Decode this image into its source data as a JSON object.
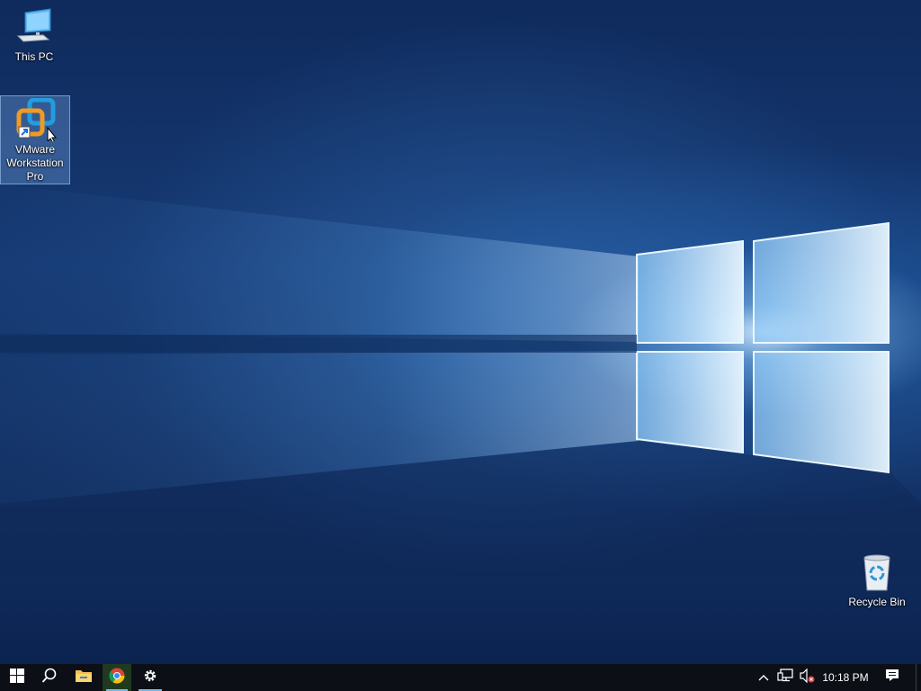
{
  "desktop": {
    "icons": [
      {
        "label": "This PC",
        "icon": "computer-icon"
      },
      {
        "label": "VMware\nWorkstation\nPro",
        "icon": "vmware-icon",
        "selected": true
      },
      {
        "label": "Recycle Bin",
        "icon": "recycle-bin-icon"
      }
    ]
  },
  "taskbar": {
    "start": {
      "icon": "windows-logo-icon"
    },
    "search": {
      "icon": "search-icon"
    },
    "apps": [
      {
        "name": "File Explorer",
        "icon": "folder-icon",
        "running": false
      },
      {
        "name": "Google Chrome",
        "icon": "chrome-icon",
        "running": true,
        "active": true
      },
      {
        "name": "Settings",
        "icon": "gear-icon",
        "running": true
      }
    ],
    "tray": {
      "icons": [
        "chevron-up-icon",
        "network-icon",
        "volume-muted-icon"
      ],
      "clock": "10:18 PM",
      "notifications_icon": "notification-icon"
    }
  },
  "colors": {
    "taskbar": "#0c0f16",
    "accent": "#76b9ed",
    "wallpaper_dark": "#0f2a5c",
    "wallpaper_light": "#cfe8ff"
  }
}
